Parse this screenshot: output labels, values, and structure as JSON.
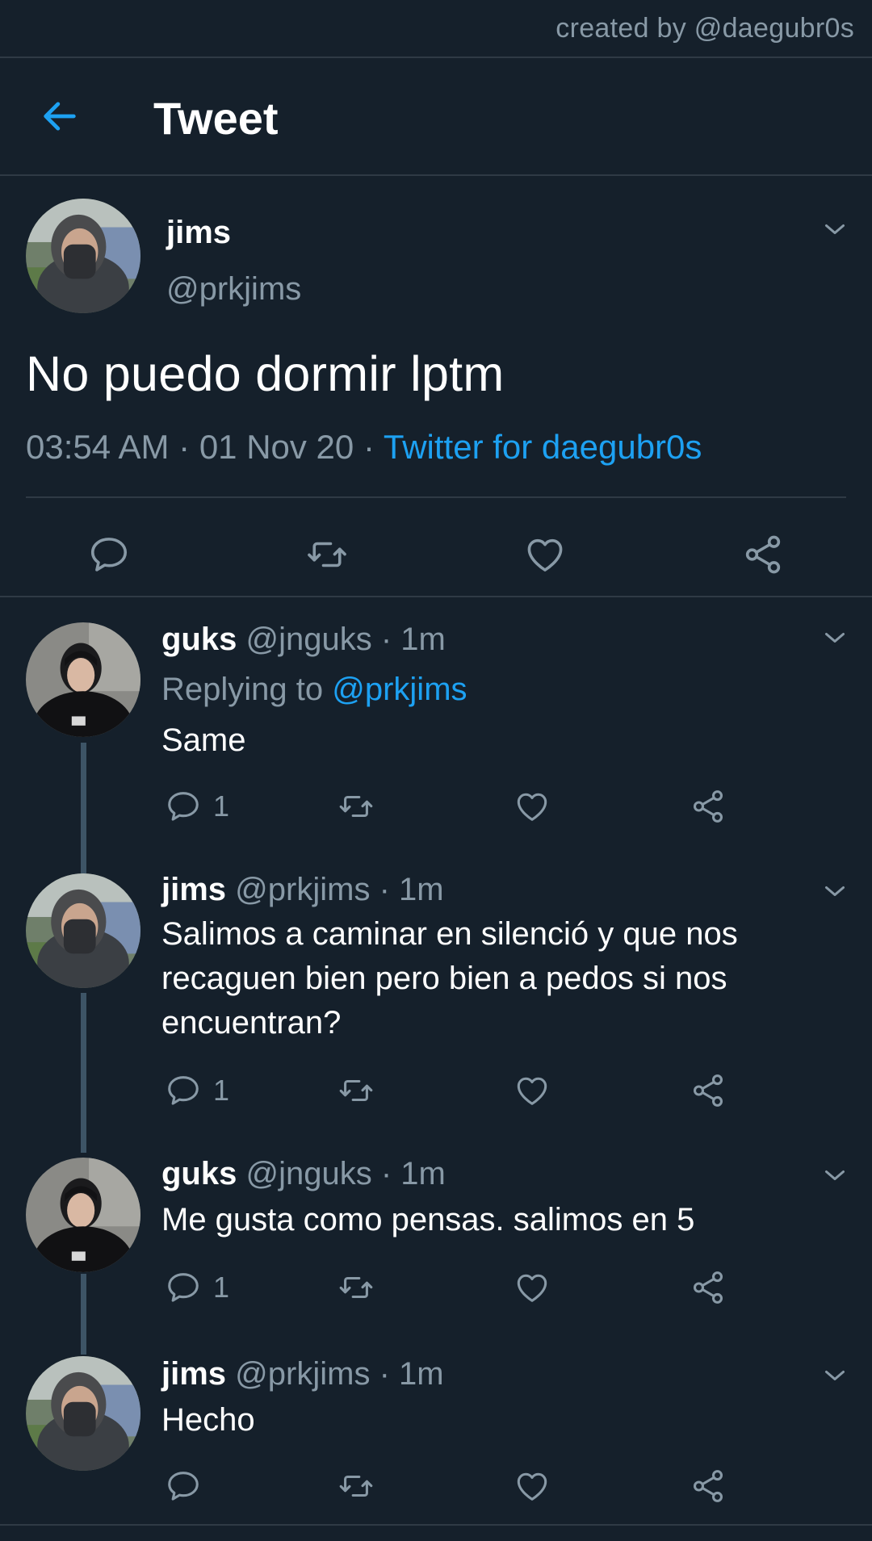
{
  "credit": "created by @daegubr0s",
  "header": {
    "title": "Tweet"
  },
  "main_tweet": {
    "name": "jims",
    "handle": "@prkjims",
    "text": "No puedo dormir lptm",
    "time": "03:54 AM",
    "sep": "·",
    "date": "01 Nov 20",
    "source": "Twitter for daegubr0s"
  },
  "replies": [
    {
      "name": "guks",
      "handle": "@jnguks",
      "time": "1m",
      "replying_label": "Replying to",
      "replying_to": "@prkjims",
      "lines": [
        "Same"
      ],
      "reply_count": "1"
    },
    {
      "name": "jims",
      "handle": "@prkjims",
      "time": "1m",
      "lines": [
        "Salimos a caminar en silenció y que nos",
        "recaguen bien pero bien a pedos si nos",
        "encuentran?"
      ],
      "reply_count": "1"
    },
    {
      "name": "guks",
      "handle": "@jnguks",
      "time": "1m",
      "lines": [
        "Me gusta como pensas. salimos en 5"
      ],
      "reply_count": "1"
    },
    {
      "name": "jims",
      "handle": "@prkjims",
      "time": "1m",
      "lines": [
        "Hecho"
      ],
      "reply_count": ""
    }
  ],
  "colors": {
    "background": "#15202b",
    "accent": "#1da1f2",
    "secondary_text": "#8899a6",
    "divider": "#2f3a45",
    "thread_line": "#3d5466"
  },
  "icons": [
    "back-arrow-icon",
    "chevron-down-icon",
    "reply-icon",
    "retweet-icon",
    "like-icon",
    "share-icon"
  ]
}
